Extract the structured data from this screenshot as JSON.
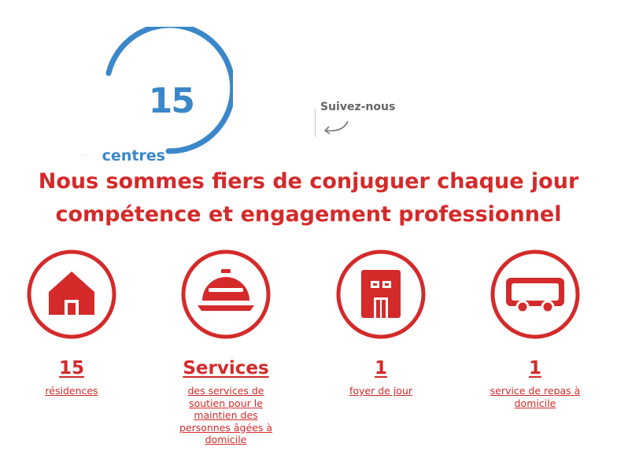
{
  "counter": {
    "value": "15",
    "label": "centres"
  },
  "social": {
    "label": "Suivez-nous"
  },
  "headline": {
    "line1": "Nous sommes fiers de conjuguer chaque jour",
    "line2": "compétence et engagement professionnel"
  },
  "stats": [
    {
      "value": "15",
      "label": "résidences",
      "icon": "house-icon"
    },
    {
      "value": "Services",
      "label": "des services de soutien pour le maintien des personnes âgées à domicile",
      "icon": "service-bell-icon"
    },
    {
      "value": "1",
      "label": "foyer de jour",
      "icon": "building-icon"
    },
    {
      "value": "1",
      "label": "service de repas à domicile",
      "icon": "delivery-van-icon"
    }
  ],
  "colors": {
    "accent": "#d42a2a",
    "counter": "#3b87c9",
    "muted": "#666666"
  }
}
